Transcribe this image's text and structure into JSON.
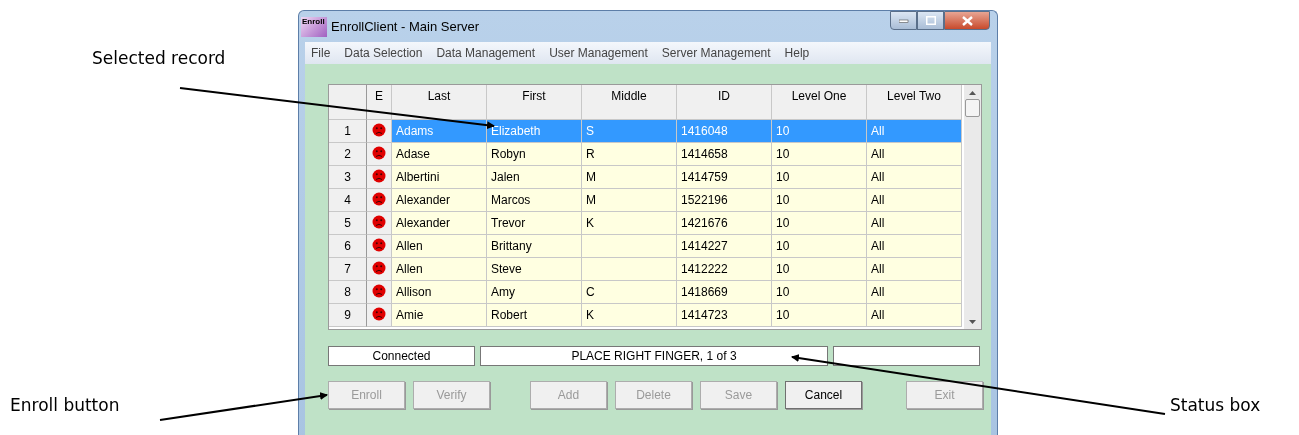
{
  "annotations": [
    {
      "label": "Selected record"
    },
    {
      "label": "Enroll button"
    },
    {
      "label": "Status box"
    }
  ],
  "window": {
    "title": "EnrollClient - Main Server",
    "icon_text": "Enroll"
  },
  "menu": [
    {
      "label": "File"
    },
    {
      "label": "Data Selection"
    },
    {
      "label": "Data Management"
    },
    {
      "label": "User Management"
    },
    {
      "label": "Server Management"
    },
    {
      "label": "Help"
    }
  ],
  "table": {
    "columns": [
      "E",
      "Last",
      "First",
      "Middle",
      "ID",
      "Level One",
      "Level Two"
    ],
    "rows": [
      {
        "number": "1",
        "last": "Adams",
        "first": "Elizabeth",
        "middle": "S",
        "id": "1416048",
        "level_one": "10",
        "level_two": "All",
        "selected": true
      },
      {
        "number": "2",
        "last": "Adase",
        "first": "Robyn",
        "middle": "R",
        "id": "1414658",
        "level_one": "10",
        "level_two": "All",
        "selected": false
      },
      {
        "number": "3",
        "last": "Albertini",
        "first": "Jalen",
        "middle": "M",
        "id": "1414759",
        "level_one": "10",
        "level_two": "All",
        "selected": false
      },
      {
        "number": "4",
        "last": "Alexander",
        "first": "Marcos",
        "middle": "M",
        "id": "1522196",
        "level_one": "10",
        "level_two": "All",
        "selected": false
      },
      {
        "number": "5",
        "last": "Alexander",
        "first": "Trevor",
        "middle": "K",
        "id": "1421676",
        "level_one": "10",
        "level_two": "All",
        "selected": false
      },
      {
        "number": "6",
        "last": "Allen",
        "first": "Brittany",
        "id": "1414227",
        "level_one": "10",
        "level_two": "All",
        "selected": false
      },
      {
        "number": "7",
        "last": "Allen",
        "first": "Steve",
        "id": "1412222",
        "level_one": "10",
        "level_two": "All",
        "selected": false
      },
      {
        "number": "8",
        "last": "Allison",
        "first": "Amy",
        "middle": "C",
        "id": "1418669",
        "level_one": "10",
        "level_two": "All",
        "selected": false
      },
      {
        "number": "9",
        "last": "Amie",
        "first": "Robert",
        "middle": "K",
        "id": "1414723",
        "level_one": "10",
        "level_two": "All",
        "selected": false
      }
    ]
  },
  "status_bar": {
    "connection": "Connected",
    "message": "PLACE RIGHT FINGER, 1 of 3"
  },
  "buttons": [
    {
      "label": "Enroll",
      "disabled": true
    },
    {
      "label": "Verify",
      "disabled": true
    },
    {
      "label": "Add",
      "disabled": true
    },
    {
      "label": "Delete",
      "disabled": true
    },
    {
      "label": "Save",
      "disabled": true
    },
    {
      "label": "Cancel",
      "disabled": false
    },
    {
      "label": "Exit",
      "disabled": true
    }
  ]
}
